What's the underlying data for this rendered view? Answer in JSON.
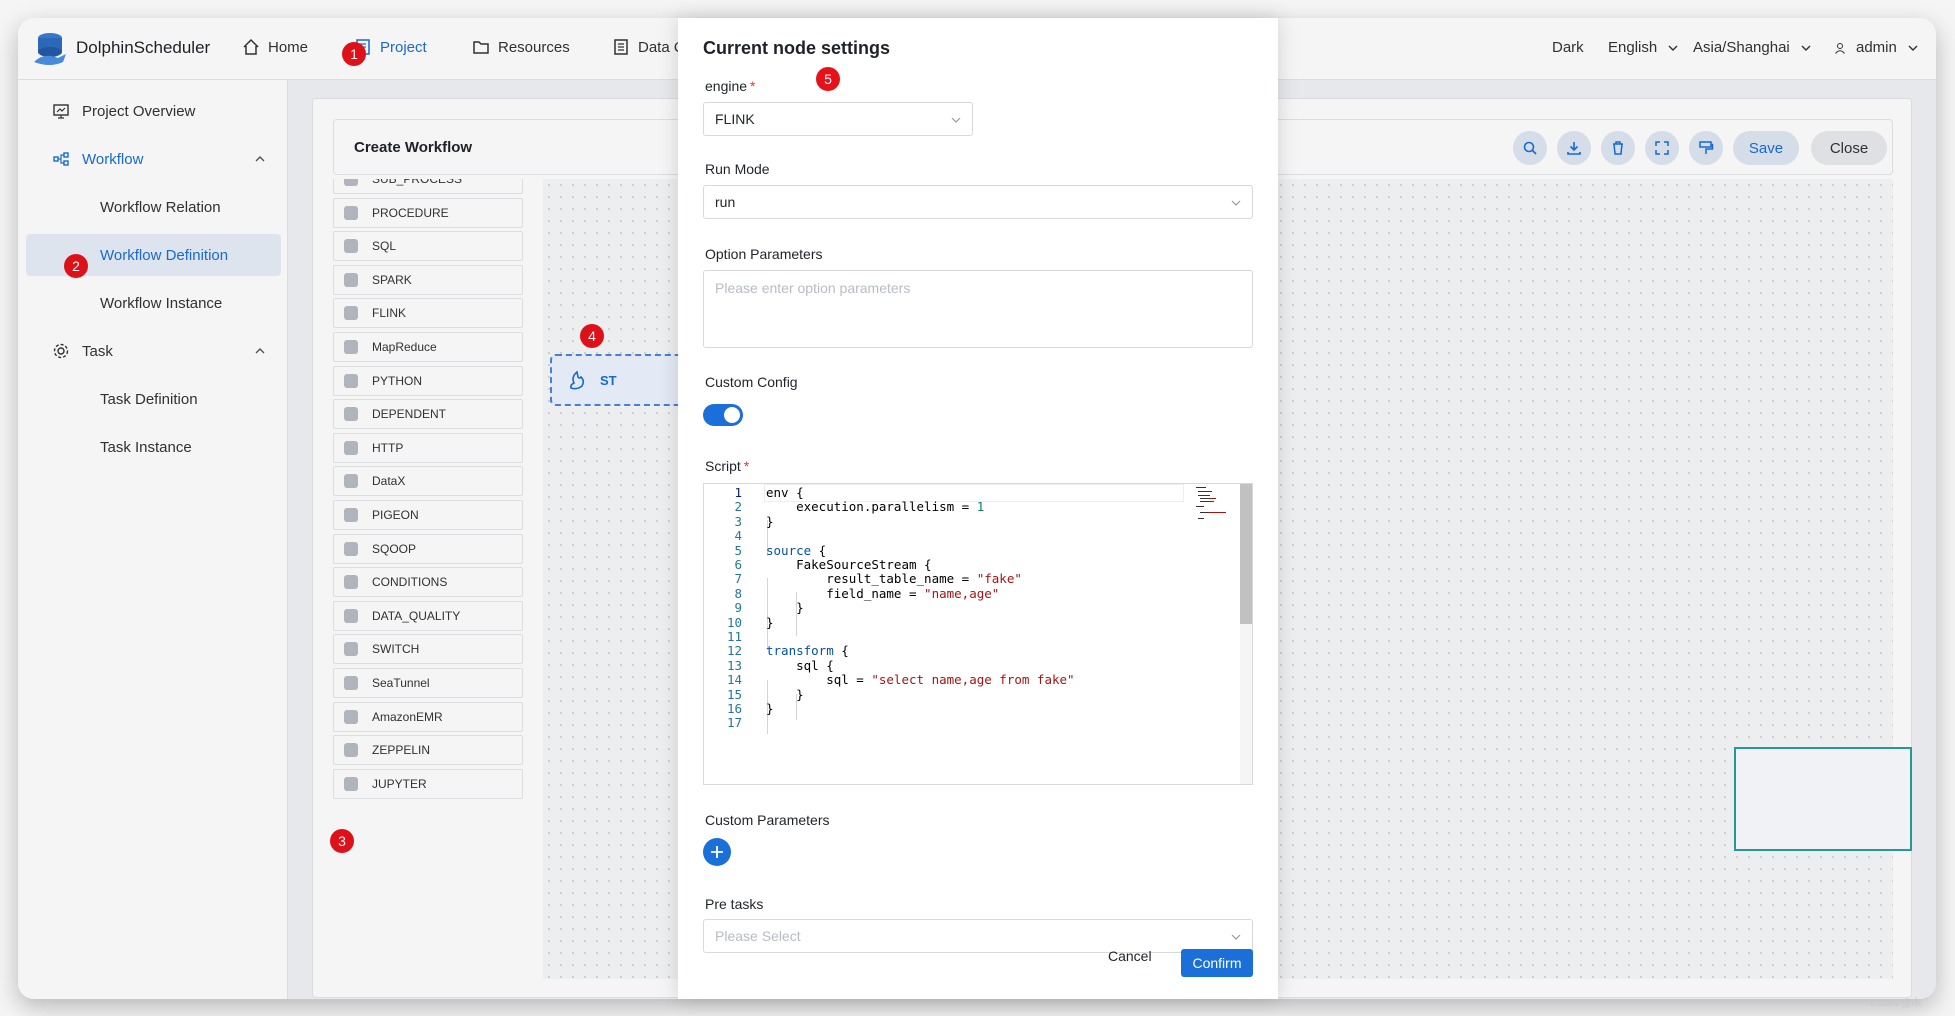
{
  "header": {
    "brand": "DolphinScheduler",
    "nav": {
      "home": "Home",
      "project": "Project",
      "resources": "Resources",
      "data_quality": "Data Q"
    },
    "theme": "Dark",
    "language": "English",
    "timezone": "Asia/Shanghai",
    "user": "admin"
  },
  "sidebar": {
    "project_overview": "Project Overview",
    "workflow": "Workflow",
    "workflow_relation": "Workflow Relation",
    "workflow_definition": "Workflow Definition",
    "workflow_instance": "Workflow Instance",
    "task": "Task",
    "task_definition": "Task Definition",
    "task_instance": "Task Instance"
  },
  "canvas": {
    "title": "Create Workflow",
    "save": "Save",
    "close": "Close",
    "node_label": "ST"
  },
  "toolbox": [
    "SUB_PROCESS",
    "PROCEDURE",
    "SQL",
    "SPARK",
    "FLINK",
    "MapReduce",
    "PYTHON",
    "DEPENDENT",
    "HTTP",
    "DataX",
    "PIGEON",
    "SQOOP",
    "CONDITIONS",
    "DATA_QUALITY",
    "SWITCH",
    "SeaTunnel",
    "AmazonEMR",
    "ZEPPELIN",
    "JUPYTER"
  ],
  "modal": {
    "title": "Current node settings",
    "engine_label": "engine",
    "engine_value": "FLINK",
    "run_mode_label": "Run Mode",
    "run_mode_value": "run",
    "option_params_label": "Option Parameters",
    "option_params_placeholder": "Please enter option parameters",
    "custom_config_label": "Custom Config",
    "custom_config_enabled": true,
    "script_label": "Script",
    "script_lines": [
      "env {",
      "    execution.parallelism = 1",
      "}",
      "",
      "source {",
      "    FakeSourceStream {",
      "        result_table_name = \"fake\"",
      "        field_name = \"name,age\"",
      "    }",
      "}",
      "",
      "transform {",
      "    sql {",
      "        sql = \"select name,age from fake\"",
      "    }",
      "}",
      ""
    ],
    "custom_params_label": "Custom Parameters",
    "pre_tasks_label": "Pre tasks",
    "pre_tasks_placeholder": "Please Select",
    "cancel": "Cancel",
    "confirm": "Confirm"
  },
  "annotations": [
    "1",
    "2",
    "3",
    "4",
    "5"
  ],
  "watermark": "CSDN @木"
}
